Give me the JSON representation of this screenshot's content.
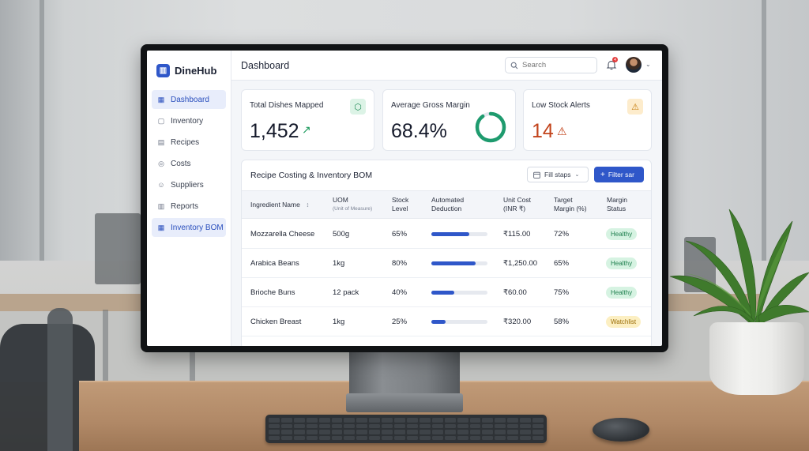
{
  "app": {
    "brand": "DineHub",
    "brand_logo_glyph": "▥"
  },
  "sidebar": {
    "items": [
      {
        "label": "Dashboard",
        "icon": "grid-icon",
        "glyph": "▦",
        "active": true
      },
      {
        "label": "Inventory",
        "icon": "box-icon",
        "glyph": "▢",
        "active": false
      },
      {
        "label": "Recipes",
        "icon": "clipboard-icon",
        "glyph": "▤",
        "active": false
      },
      {
        "label": "Costs",
        "icon": "coin-icon",
        "glyph": "◎",
        "active": false
      },
      {
        "label": "Suppliers",
        "icon": "users-icon",
        "glyph": "☺",
        "active": false
      },
      {
        "label": "Reports",
        "icon": "chart-icon",
        "glyph": "▥",
        "active": false
      },
      {
        "label": "Inventory BOM",
        "icon": "apps-icon",
        "glyph": "▦",
        "active": true
      }
    ]
  },
  "header": {
    "title": "Dashboard",
    "search_placeholder": "Search",
    "notification_count": "4",
    "caret": "⌄"
  },
  "kpis": {
    "dishes": {
      "label": "Total Dishes Mapped",
      "value": "1,452",
      "trend": "↗",
      "icon": "layers-icon",
      "glyph": "⬡"
    },
    "margin": {
      "label": "Average Gross Margin",
      "value": "68.4%",
      "ring_fraction": 0.9
    },
    "alerts": {
      "label": "Low Stock Alerts",
      "value": "14",
      "icon": "warning-icon",
      "glyph": "⚠"
    }
  },
  "table": {
    "title": "Recipe Costing & Inventory BOM",
    "fill_button": "Fill staps",
    "filter_button": "Filter sar",
    "columns": {
      "ingredient": "Ingredient Name",
      "sort_glyph": "↕",
      "uom": "UOM",
      "uom_sub": "(Unit of Measure)",
      "stock_1": "Stock",
      "stock_2": "Level",
      "deduction_1": "Automated",
      "deduction_2": "Deduction",
      "cost_1": "Unit Cost",
      "cost_2": "(INR ₹)",
      "target_1": "Target",
      "target_2": "Margin (%)",
      "status_1": "Margin",
      "status_2": "Status"
    },
    "rows": [
      {
        "ingredient": "Mozzarella Cheese",
        "uom": "500g",
        "stock": "65%",
        "deduction": 0.68,
        "cost": "₹115.00",
        "target": "72%",
        "status": "Healthy",
        "status_kind": "healthy"
      },
      {
        "ingredient": "Arabica Beans",
        "uom": "1kg",
        "stock": "80%",
        "deduction": 0.79,
        "cost": "₹1,250.00",
        "target": "65%",
        "status": "Healthy",
        "status_kind": "healthy"
      },
      {
        "ingredient": "Brioche Buns",
        "uom": "12 pack",
        "stock": "40%",
        "deduction": 0.41,
        "cost": "₹60.00",
        "target": "75%",
        "status": "Healthy",
        "status_kind": "healthy"
      },
      {
        "ingredient": "Chicken Breast",
        "uom": "1kg",
        "stock": "25%",
        "deduction": 0.26,
        "cost": "₹320.00",
        "target": "58%",
        "status": "Watchlist",
        "status_kind": "watch"
      }
    ]
  },
  "colors": {
    "accent": "#2f57c9",
    "success": "#1e9b5e",
    "danger": "#c2431b"
  }
}
